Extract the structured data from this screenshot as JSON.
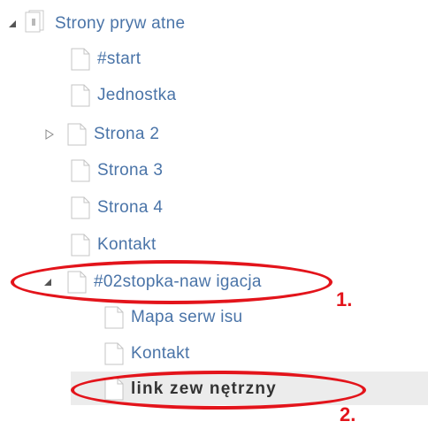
{
  "tree": {
    "root": {
      "label": "Strony pryw atne",
      "expanded": true
    },
    "items": [
      {
        "label": "#start"
      },
      {
        "label": "Jednostka"
      },
      {
        "label": "Strona 2",
        "collapsed": true
      },
      {
        "label": "Strona 3"
      },
      {
        "label": "Strona 4"
      },
      {
        "label": "Kontakt"
      },
      {
        "label": "#02stopka-naw igacja",
        "expanded": true,
        "children": [
          {
            "label": "Mapa serw isu"
          },
          {
            "label": "Kontakt"
          },
          {
            "label": "link zew nętrzny",
            "selected": true
          }
        ]
      }
    ]
  },
  "annotations": {
    "first": "1.",
    "second": "2."
  },
  "colors": {
    "link": "#4a74a8",
    "annotation": "#e3141b",
    "selected_background": "#ececec"
  },
  "icons": [
    "triangle-expanded-icon",
    "triangle-collapsed-icon",
    "page-icon",
    "root-pages-icon"
  ]
}
